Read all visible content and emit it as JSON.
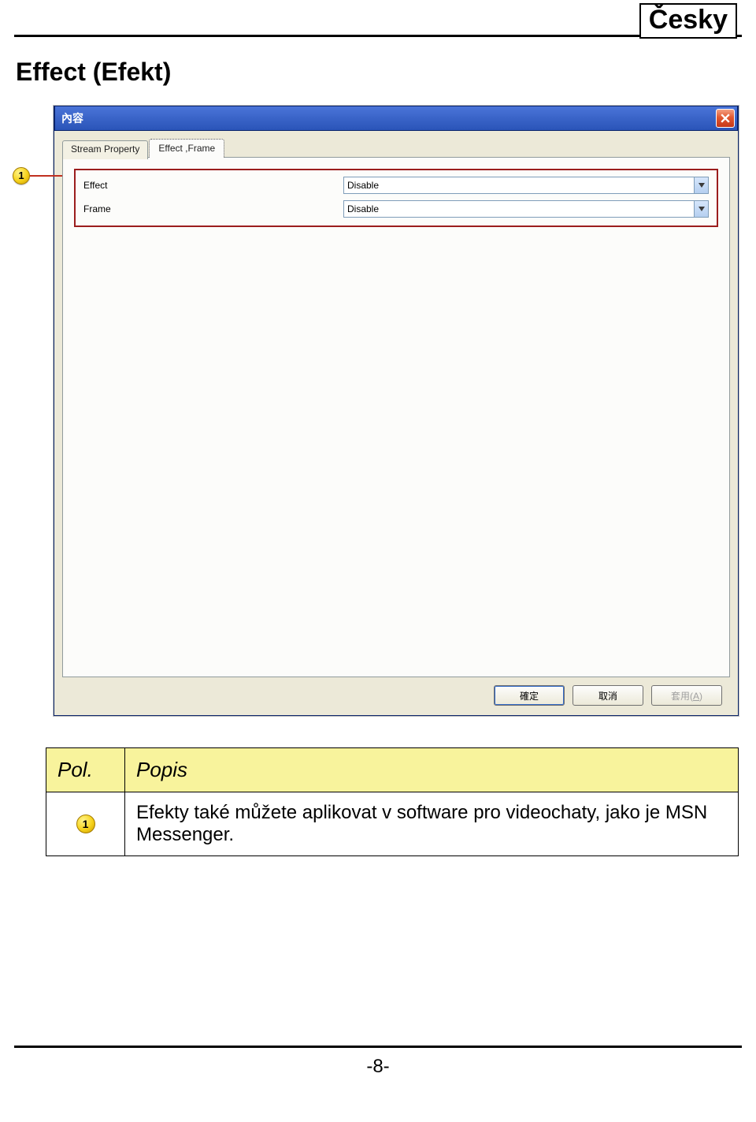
{
  "language_label": "Česky",
  "heading": "Effect (Efekt)",
  "callout_number": "1",
  "dialog": {
    "title": "內容",
    "tabs": {
      "inactive": "Stream Property",
      "active": "Effect ,Frame"
    },
    "rows": {
      "effect_label": "Effect",
      "effect_value": "Disable",
      "frame_label": "Frame",
      "frame_value": "Disable"
    },
    "buttons": {
      "ok": "確定",
      "cancel": "取消",
      "apply": "套用(A)",
      "apply_key": "A"
    }
  },
  "table": {
    "header_pol": "Pol.",
    "header_popis": "Popis",
    "row1_marker": "1",
    "row1_text": "Efekty také můžete aplikovat v software pro videochaty, jako je MSN Messenger."
  },
  "page_number": "-8-"
}
